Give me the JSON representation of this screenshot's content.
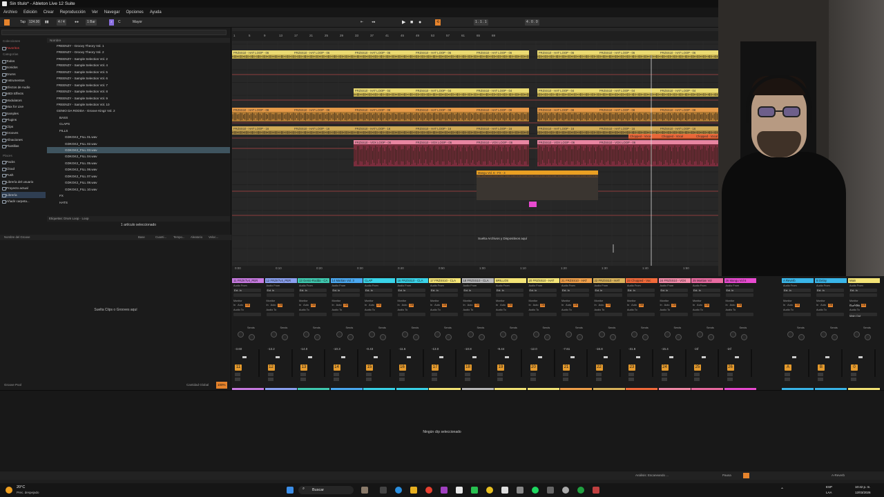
{
  "window": {
    "title": "Sin título* - Ableton Live 12 Suite"
  },
  "menu": [
    "Archivo",
    "Edición",
    "Crear",
    "Reproducción",
    "Ver",
    "Navegar",
    "Opciones",
    "Ayuda"
  ],
  "control_bar": {
    "tap": "Tap",
    "tempo": "124.00",
    "signature": "4 / 4",
    "metro": "1 Bar",
    "key": "C",
    "scale": "Mayor",
    "position": "1 . 1 . 1",
    "loop_length": "4 . 0 . 0"
  },
  "browser": {
    "categories_header": "Colecciones",
    "favorites": "Favoritos",
    "categories_label": "Categorías",
    "categories": [
      "Todos",
      "Sonidos",
      "Drums",
      "Instrumentos",
      "Efectos de Audio",
      "MIDI Effects",
      "Modulators",
      "Max for Live",
      "Samples",
      "Plugins",
      "Clips",
      "Grooves",
      "Afinaciones",
      "Plantillas"
    ],
    "places_label": "Places",
    "places": [
      "Packs",
      "Cloud",
      "Push",
      "Librería del usuario",
      "Proyecto actual",
      "Librería",
      "Añadir carpeta..."
    ],
    "selected_place": "Librería",
    "name_header": "Nombre",
    "files": [
      "FREENZY - Groovy Theory Vol. 1",
      "FREENZY - Groovy Theory Vol. 2",
      "FREENZY - Sample Selection Vol. 2",
      "FREENZY - Sample Selection Vol. 4",
      "FREENZY - Sample Selection Vol. 5",
      "FREENZY - Sample Selection Vol. 6",
      "FREENZY - Sample Selection Vol. 7",
      "FREENZY - Sample Selection Vol. 8",
      "FREENZY - Sample Selection Vol. 9",
      "FREENZY - Sample Selection Vol. 10",
      "GENIO DA RODDA - Groove Kingz Vol. 2",
      "BASS",
      "CLAPS",
      "FILLS",
      "GDKGK2_FILL 01.wav",
      "GDKGK2_FILL 02.wav",
      "GDKGK2_FILL 03.wav",
      "GDKGK2_FILL 04.wav",
      "GDKGK2_FILL 05.wav",
      "GDKGK2_FILL 06.wav",
      "GDKGK2_FILL 07.wav",
      "GDKGK2_FILL 08.wav",
      "GDKGK2_FILL 10.wav",
      "FX",
      "HATS"
    ],
    "selected_file_index": 16,
    "tags_status": "Etiquetas: Drum Loop · Loop",
    "selection_count": "1 artículo seleccionado"
  },
  "groove_pool": {
    "headers": [
      "Nombre del Groove",
      "Base",
      "Cuanti...",
      "Tempo...",
      "Aleatorio",
      "Veloc..."
    ],
    "drop_hint": "Suelta Clips o Grooves aquí",
    "footer_left": "Groove Pool",
    "global_amount_label": "Cantidad Global",
    "global_amount": "100%"
  },
  "arrangement": {
    "ruler_marks": [
      "1",
      "5",
      "9",
      "13",
      "17",
      "21",
      "25",
      "29",
      "33",
      "37",
      "41",
      "45",
      "49",
      "53",
      "57",
      "61",
      "65",
      "69"
    ],
    "time_marks": [
      "0:00",
      "0:10",
      "0:20",
      "0:30",
      "0:40",
      "0:50",
      "1:00",
      "1:10",
      "1:20",
      "1:30",
      "1:40",
      "1:50"
    ],
    "clips": [
      {
        "label": "FRZSS10 - HAT LOOP - 06",
        "color": "#f4e476"
      },
      {
        "label": "FRZSS10 - HAT LOOP - 04",
        "color": "#f4e476"
      },
      {
        "label": "FRZSS10 - HAT LOOP - 08",
        "color": "#f0a04a"
      },
      {
        "label": "FRZSS10 - HAT LOOP - 16",
        "color": "#d9b25a"
      },
      {
        "label": "FRZSS10 - VOX LOOP - 06",
        "color": "#f28aa8"
      },
      {
        "label": "Chopped - Vocal",
        "color": "#f26a3a"
      },
      {
        "label": "Mangu Vol. 6 - FX - 3",
        "color": "#f5a623"
      }
    ],
    "drop_hint": "Suelta Archivos y Dispositivos aquí"
  },
  "mixer": {
    "tracks": [
      {
        "name": "11 FRZKTv4_PER",
        "color": "#c77ae0",
        "volume": "-3.60",
        "number": "11"
      },
      {
        "name": "12 FRZKTv4_PER",
        "color": "#8aa0f0",
        "volume": "-13.2",
        "number": "12"
      },
      {
        "name": "13 Genio-Rodda - CA",
        "color": "#3fc9b0",
        "volume": "-14.0",
        "number": "13"
      },
      {
        "name": "14 Martian Vol. 3",
        "color": "#4aa8f0",
        "volume": "-10.3",
        "number": "14"
      },
      {
        "name": "CLAP",
        "color": "#39d3e8",
        "volume": "-0.43",
        "number": "15"
      },
      {
        "name": "16 FRZSS10 - CLA",
        "color": "#39d3e8",
        "volume": "-11.6",
        "number": "16"
      },
      {
        "name": "17 FRZSS10 - CLA",
        "color": "#f4e476",
        "volume": "-13.0",
        "number": "17"
      },
      {
        "name": "18 FRZSS10 - CLA",
        "color": "#b8b8b8",
        "volume": "-10.8",
        "number": "18"
      },
      {
        "name": "BRILLOS",
        "color": "#f4e476",
        "volume": "-9.44",
        "number": "19"
      },
      {
        "name": "20 FRZSS10 - HAT",
        "color": "#f4e476",
        "volume": "-12.0",
        "number": "20"
      },
      {
        "name": "21 FRZSS10 - HAT",
        "color": "#f0a04a",
        "volume": "-7.61",
        "number": "21"
      },
      {
        "name": "22 FRZSS10 - HAT",
        "color": "#d9b25a",
        "volume": "-16.8",
        "number": "22"
      },
      {
        "name": "23 Chopped - Voc",
        "color": "#f26a3a",
        "volume": "-31.8",
        "number": "23"
      },
      {
        "name": "24 FRZSS10 - VOX",
        "color": "#f28aa8",
        "volume": "-15.4",
        "number": "24"
      },
      {
        "name": "25 Martian Vol",
        "color": "#e86aa0",
        "volume": "-inf",
        "number": "25"
      },
      {
        "name": "26 Mangu Vol 6",
        "color": "#e84ad0",
        "volume": "-inf",
        "number": "26"
      }
    ],
    "returns": [
      {
        "name": "A Reverb",
        "color": "#39b5e8",
        "number": "A"
      },
      {
        "name": "B Delay",
        "color": "#39b5e8",
        "number": "B"
      },
      {
        "name": "Main",
        "color": "#f4e476",
        "number": "0"
      }
    ],
    "labels": {
      "audio_from": "Audio From",
      "ext_in": "Ext. In",
      "monitor": "Monitor",
      "in": "In",
      "auto": "Auto",
      "off": "Off",
      "audio_to": "Audio To",
      "sends": "Sends",
      "cue_out": "Cue Out",
      "main_out": "Main Out",
      "routing_percus": "PERCUS",
      "routing_main": "Main",
      "routing_clap": "CLAP",
      "routing_brillos": "BRILLOS"
    }
  },
  "detail": {
    "message": "Ningún clip seleccionado"
  },
  "status": {
    "left": "Análisis: Escaneando ...",
    "pause": "Pausa",
    "right": "A-Reverb"
  },
  "taskbar": {
    "weather_temp": "20°C",
    "weather_desc": "Prec. despejado",
    "search": "Buscar",
    "lang": "ESP",
    "layout": "LAA",
    "time": "10:42 p. m.",
    "date": "12/03/2026"
  }
}
